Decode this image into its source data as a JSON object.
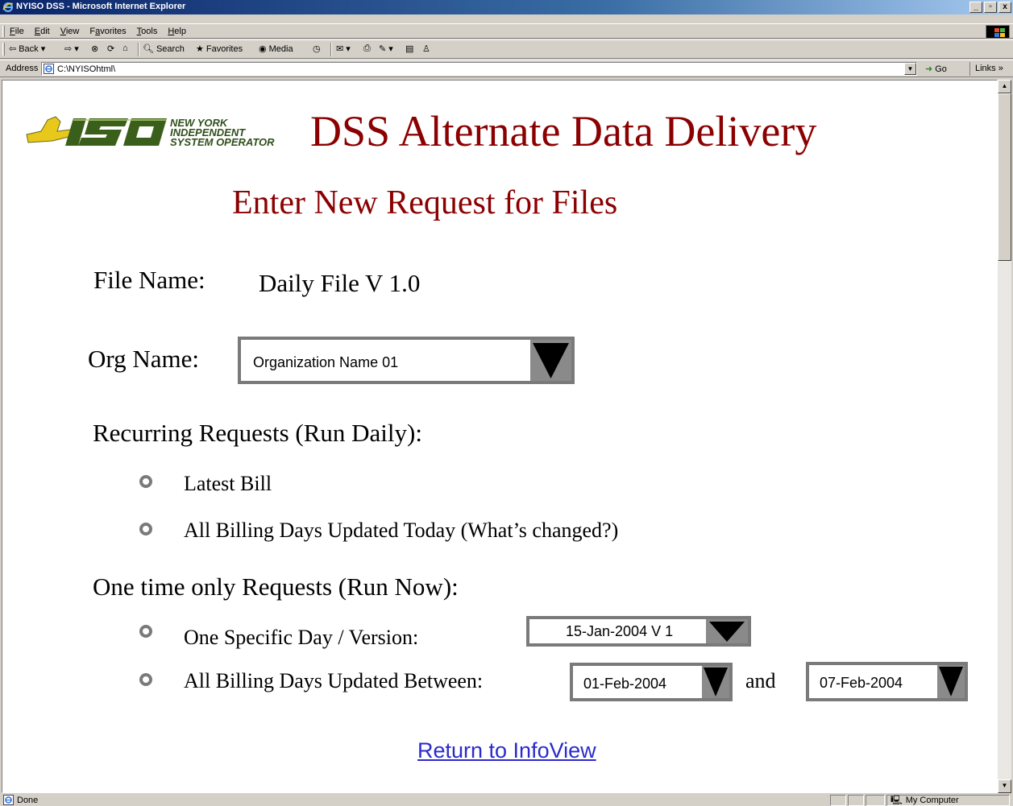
{
  "window": {
    "title": "NYISO DSS - Microsoft Internet Explorer",
    "controls": {
      "minimize": "_",
      "maximize": "▫",
      "close": "x"
    }
  },
  "menu": {
    "items": [
      {
        "label": "File",
        "access": "F"
      },
      {
        "label": "Edit",
        "access": "E"
      },
      {
        "label": "View",
        "access": "V"
      },
      {
        "label": "Favorites",
        "access": "a"
      },
      {
        "label": "Tools",
        "access": "T"
      },
      {
        "label": "Help",
        "access": "H"
      }
    ]
  },
  "toolbar": {
    "back": "Back",
    "search": "Search",
    "favorites": "Favorites",
    "media": "Media"
  },
  "address": {
    "label": "Address",
    "value": "C:\\NYISOhtml\\",
    "go": "Go",
    "links": "Links »"
  },
  "page": {
    "logo_line1": "NEW YORK",
    "logo_line2": "INDEPENDENT",
    "logo_line3": "SYSTEM OPERATOR",
    "logo_mark": "ISO",
    "title": "DSS Alternate Data Delivery",
    "subtitle": "Enter New Request for Files",
    "file_name_label": "File Name:",
    "file_name_value": "Daily File V 1.0",
    "org_name_label": "Org Name:",
    "org_name_value": "Organization Name 01",
    "recurring_heading": "Recurring Requests (Run Daily):",
    "recurring_options": [
      "Latest Bill",
      "All Billing Days Updated Today (What’s changed?)"
    ],
    "onetime_heading": "One time only Requests (Run Now):",
    "specific_day_label": "One Specific Day / Version:",
    "specific_day_value": "15-Jan-2004 V 1",
    "between_label": "All Billing Days Updated Between:",
    "between_start": "01-Feb-2004",
    "between_and": "and",
    "between_end": "07-Feb-2004",
    "return_link": "Return to InfoView"
  },
  "status": {
    "text": "Done",
    "zone": "My Computer"
  },
  "colors": {
    "heading": "#8b0000",
    "link": "#2a2acd",
    "select_border": "#7a7a7a"
  }
}
